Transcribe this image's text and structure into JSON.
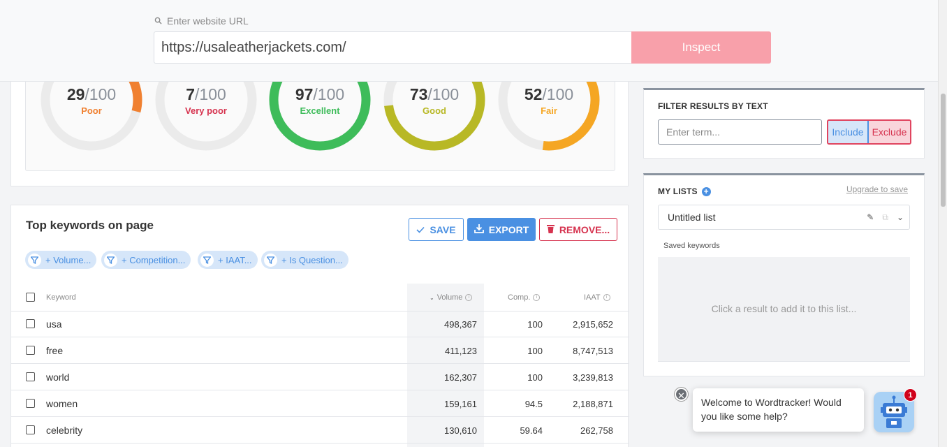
{
  "search": {
    "label": "Enter website URL",
    "url": "https://usaleatherjackets.com/",
    "inspect_label": "Inspect"
  },
  "scores": [
    {
      "score": "29",
      "max": "/100",
      "label": "Poor",
      "color": "#f08030",
      "fraction": 0.29
    },
    {
      "score": "7",
      "max": "/100",
      "label": "Very poor",
      "color": "#d6334f",
      "fraction": 0.07
    },
    {
      "score": "97",
      "max": "/100",
      "label": "Excellent",
      "color": "#3ebc5a",
      "fraction": 0.97
    },
    {
      "score": "73",
      "max": "/100",
      "label": "Good",
      "color": "#b8b825",
      "fraction": 0.73
    },
    {
      "score": "52",
      "max": "/100",
      "label": "Fair",
      "color": "#f5a623",
      "fraction": 0.52
    }
  ],
  "keywords": {
    "title": "Top keywords on page",
    "save_label": "SAVE",
    "export_label": "EXPORT",
    "remove_label": "REMOVE...",
    "filters": [
      "+ Volume...",
      "+ Competition...",
      "+ IAAT...",
      "+ Is Question..."
    ],
    "headers": {
      "keyword": "Keyword",
      "volume": "Volume",
      "comp": "Comp.",
      "iaat": "IAAT"
    },
    "rows": [
      {
        "keyword": "usa",
        "volume": "498,367",
        "comp": "100",
        "iaat": "2,915,652"
      },
      {
        "keyword": "free",
        "volume": "411,123",
        "comp": "100",
        "iaat": "8,747,513"
      },
      {
        "keyword": "world",
        "volume": "162,307",
        "comp": "100",
        "iaat": "3,239,813"
      },
      {
        "keyword": "women",
        "volume": "159,161",
        "comp": "94.5",
        "iaat": "2,188,871"
      },
      {
        "keyword": "celebrity",
        "volume": "130,610",
        "comp": "59.64",
        "iaat": "262,758"
      }
    ]
  },
  "filter_card": {
    "title": "FILTER RESULTS BY TEXT",
    "placeholder": "Enter term...",
    "include_label": "Include",
    "exclude_label": "Exclude"
  },
  "lists_card": {
    "title": "MY LISTS",
    "upgrade_label": "Upgrade to save",
    "list_name": "Untitled list",
    "saved_label": "Saved keywords",
    "empty_text": "Click a result to add it to this list..."
  },
  "chat": {
    "message": "Welcome to Wordtracker! Would you like some help?",
    "badge": "1",
    "close_glyph": "✕"
  }
}
